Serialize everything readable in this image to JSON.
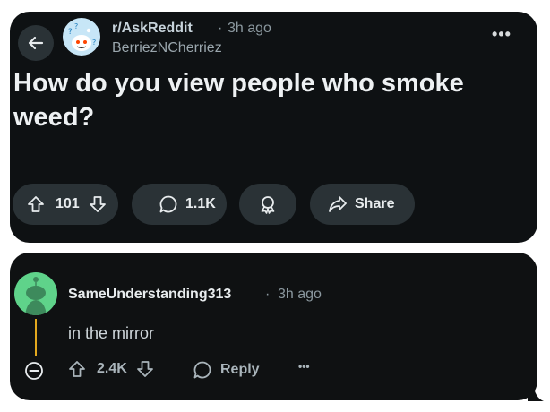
{
  "post": {
    "subreddit": "r/AskReddit",
    "separator": "·",
    "time": "3h ago",
    "author": "BerriezNCherriez",
    "title": "How do you view people who smoke weed?",
    "upvotes": "101",
    "comments": "1.1K",
    "share_label": "Share",
    "more_label": "•••"
  },
  "comment": {
    "username": "SameUnderstanding313",
    "separator": "·",
    "time": "3h ago",
    "body": "in the mirror",
    "upvotes": "2.4K",
    "reply_label": "Reply",
    "more_label": "•••"
  },
  "colors": {
    "card_bg": "#0e1113",
    "pill_bg": "#2a3236",
    "thread_line": "#e3a81e",
    "avatar_green": "#5fd38a",
    "sub_avatar_bg": "#c7e6f7"
  },
  "icons": [
    "back-arrow-icon",
    "snoo-avatar-icon",
    "more-icon",
    "upvote-icon",
    "downvote-icon",
    "comment-icon",
    "award-icon",
    "share-icon",
    "collapse-icon",
    "reply-icon"
  ]
}
